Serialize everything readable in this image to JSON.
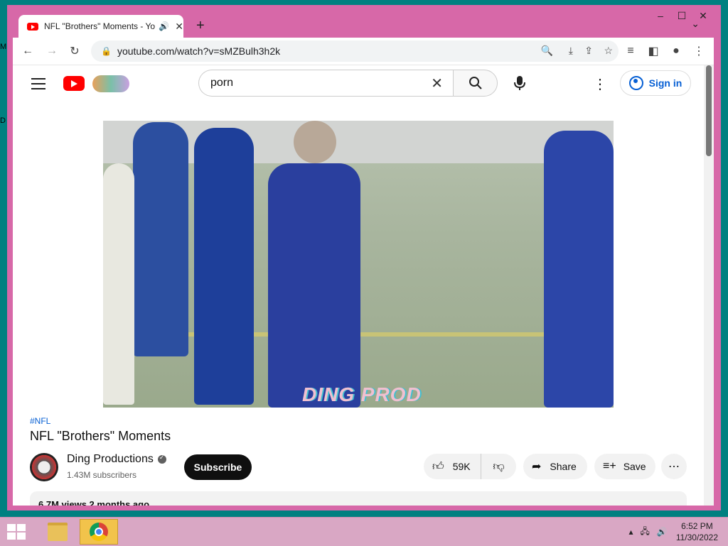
{
  "desktop": {
    "labels": [
      "M",
      "D"
    ]
  },
  "window": {
    "controls": {
      "minimize": "–",
      "maximize": "☐",
      "close": "✕"
    }
  },
  "tab": {
    "title": "NFL \"Brothers\" Moments - Yo",
    "audio_icon": "speaker-icon"
  },
  "toolbar": {
    "url": "youtube.com/watch?v=sMZBulh3h2k"
  },
  "youtube": {
    "search_query": "porn",
    "sign_in": "Sign in",
    "video": {
      "watermark": "DING PROD",
      "hashtag": "#NFL",
      "title": "NFL \"Brothers\" Moments"
    },
    "channel": {
      "name": "Ding Productions",
      "subscribers": "1.43M subscribers",
      "subscribe_label": "Subscribe"
    },
    "actions": {
      "likes": "59K",
      "share": "Share",
      "save": "Save"
    },
    "description_preview": "6.7M views  2 months ago"
  },
  "taskbar": {
    "time": "6:52 PM",
    "date": "11/30/2022"
  }
}
